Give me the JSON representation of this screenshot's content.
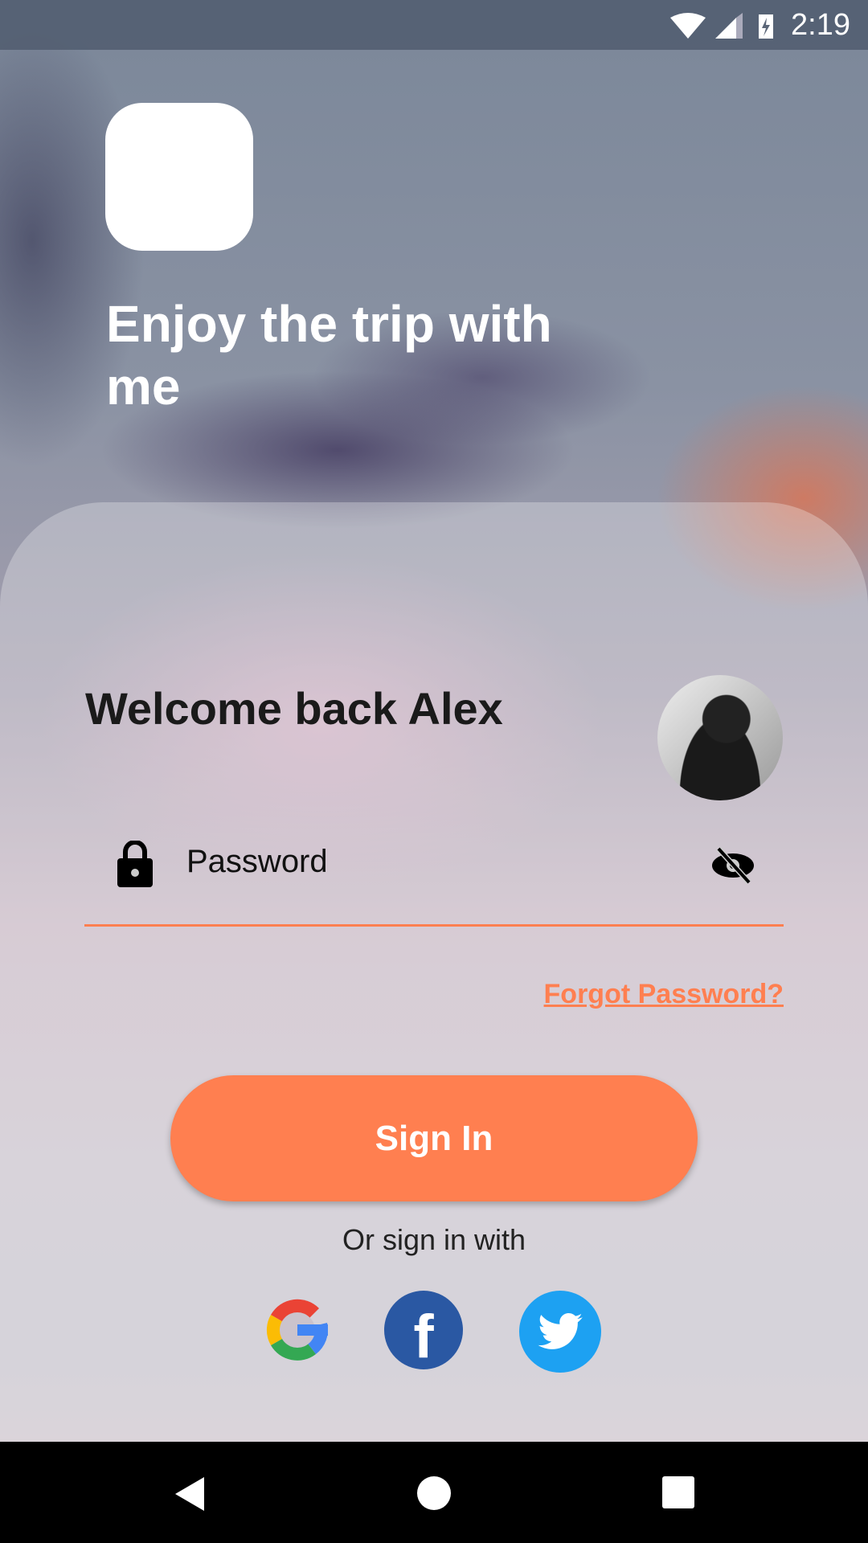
{
  "status_bar": {
    "time": "2:19",
    "icons": [
      "wifi-off-icon",
      "signal-icon",
      "battery-charging-icon"
    ]
  },
  "header": {
    "tagline": "Enjoy the trip with me"
  },
  "login": {
    "welcome": "Welcome back Alex",
    "password_placeholder": "Password",
    "forgot_password": "Forgot Password?",
    "sign_in": "Sign In",
    "or_sign_in_with": "Or sign in with"
  },
  "social": [
    "google",
    "facebook",
    "twitter"
  ],
  "colors": {
    "accent": "#ff7f50",
    "facebook": "#2a58a3",
    "twitter": "#1da1f2"
  }
}
